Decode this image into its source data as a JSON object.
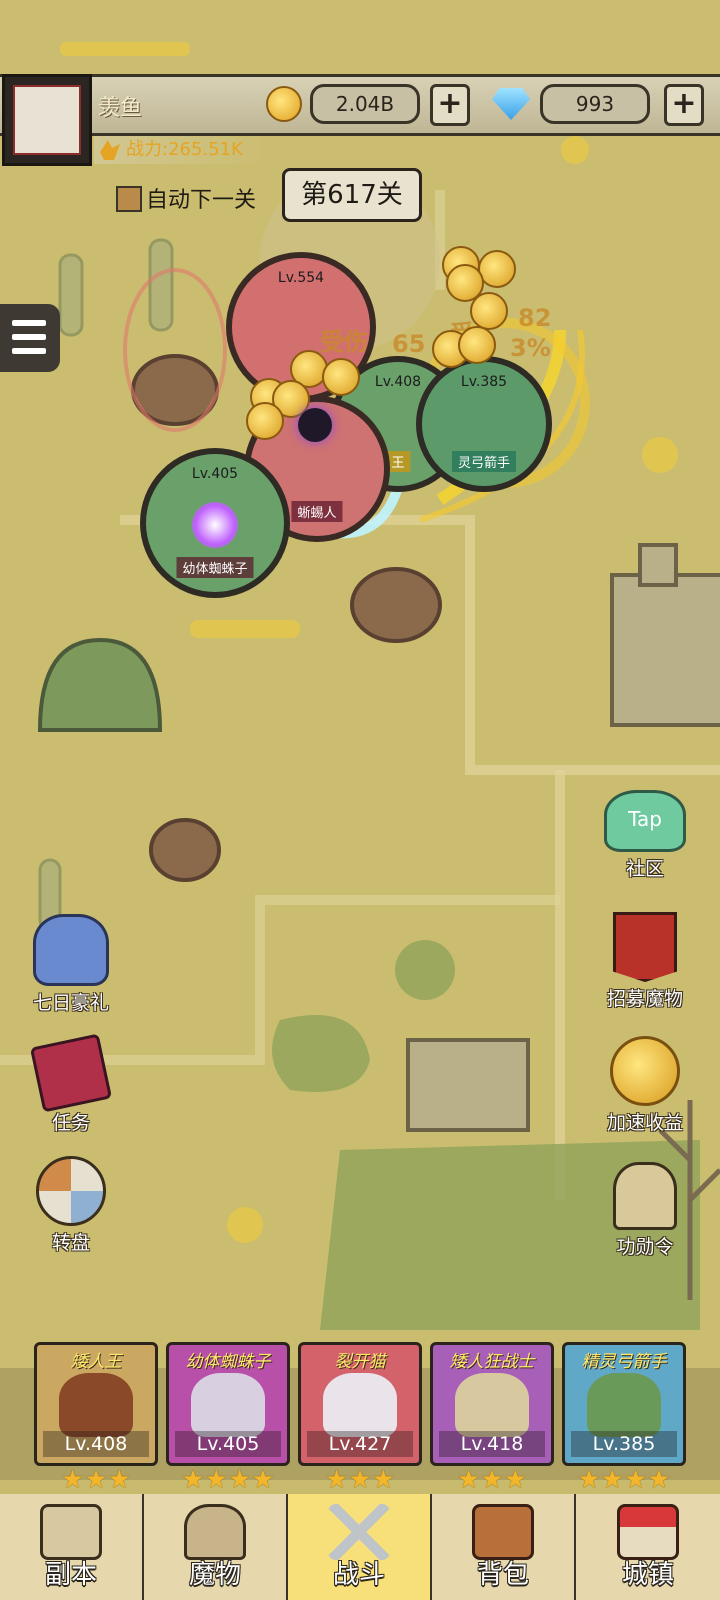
{
  "player": {
    "name": "羡鱼",
    "power_label": "战力:265.51K"
  },
  "currency": {
    "gold": "2.04B",
    "gems": "993",
    "add_label": "+"
  },
  "battle": {
    "auto_next_label": "自动下一关",
    "stage_label": "第617关",
    "damage_text": [
      "受伤",
      "65",
      "受",
      "82",
      "3%"
    ],
    "units": [
      {
        "level": "Lv.554",
        "name": ""
      },
      {
        "level": "Lv.408",
        "name": "王"
      },
      {
        "level": "Lv.385",
        "name": "灵弓箭手"
      },
      {
        "level": "Lv.4",
        "name": "蜥蜴人"
      },
      {
        "level": "Lv.405",
        "name": "幼体蜘蛛子"
      }
    ]
  },
  "side_buttons": {
    "community": {
      "tap": "Tap",
      "label": "社区"
    },
    "recruit": "招募魔物",
    "seven_day": "七日豪礼",
    "speed": "加速收益",
    "tasks": "任务",
    "wheel": "转盘",
    "merit": "功勋令"
  },
  "team": [
    {
      "title": "矮人王",
      "level": "Lv.408",
      "stars": "★★★",
      "color": "#c9a55a"
    },
    {
      "title": "幼体蜘蛛子",
      "level": "Lv.405",
      "stars": "★★★★",
      "color": "#b84fa8"
    },
    {
      "title": "裂开猫",
      "level": "Lv.427",
      "stars": "★★★",
      "color": "#d4626a"
    },
    {
      "title": "矮人狂战士",
      "level": "Lv.418",
      "stars": "★★★",
      "color": "#a85fb8"
    },
    {
      "title": "精灵弓箭手",
      "level": "Lv.385",
      "stars": "★★★★",
      "color": "#5fa8c8"
    }
  ],
  "nav": [
    "副本",
    "魔物",
    "战斗",
    "背包",
    "城镇"
  ]
}
